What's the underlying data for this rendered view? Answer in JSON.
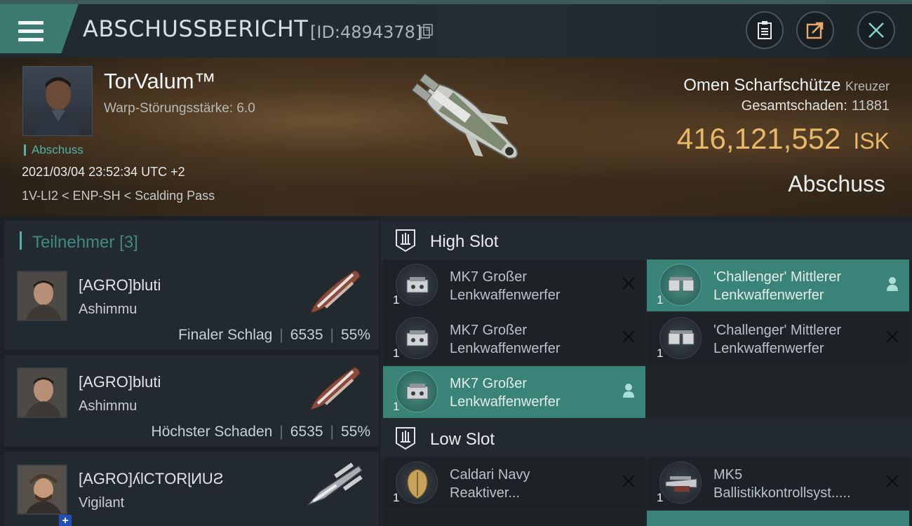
{
  "header": {
    "title": "ABSCHUSSBERICHT",
    "id_text": "[ID:4894378]"
  },
  "victim": {
    "pilot_name": "TorValum™",
    "warp_strength": "Warp-Störungsstärke: 6.0",
    "kill_tag": "Abschuss",
    "datetime": "2021/03/04 23:52:34 UTC +2",
    "location": "1V-LI2 < ENP-SH < Scalding Pass",
    "ship_name": "Omen Scharfschütze",
    "ship_class": "Kreuzer",
    "damage_label": "Gesamtschaden:",
    "damage_value": "11881",
    "isk_value": "416,121,552",
    "isk_unit": "ISK",
    "outcome": "Abschuss"
  },
  "participants": {
    "header_label": "Teilnehmer",
    "header_count": "[3]",
    "items": [
      {
        "name": "[AGRO]bluti",
        "ship": "Ashimmu",
        "role": "Finaler Schlag",
        "damage": "6535",
        "percent": "55%"
      },
      {
        "name": "[AGRO]bluti",
        "ship": "Ashimmu",
        "role": "Höchster Schaden",
        "damage": "6535",
        "percent": "55%"
      },
      {
        "name": "[AGRO]ʎlCΤORɭИUƧ",
        "ship": "Vigilant",
        "role": "",
        "damage": "",
        "percent": ""
      }
    ]
  },
  "slots": {
    "high_label": "High Slot",
    "low_label": "Low Slot",
    "high": [
      {
        "qty": "1",
        "line1": "MK7 Großer",
        "line2": "Lenkwaffenwerfer",
        "state": "destroyed"
      },
      {
        "qty": "1",
        "line1": "'Challenger' Mittlerer",
        "line2": "Lenkwaffenwerfer",
        "state": "dropped"
      },
      {
        "qty": "1",
        "line1": "MK7 Großer",
        "line2": "Lenkwaffenwerfer",
        "state": "destroyed"
      },
      {
        "qty": "1",
        "line1": "'Challenger' Mittlerer",
        "line2": "Lenkwaffenwerfer",
        "state": "destroyed"
      },
      {
        "qty": "1",
        "line1": "MK7 Großer",
        "line2": "Lenkwaffenwerfer",
        "state": "dropped"
      }
    ],
    "low": [
      {
        "qty": "1",
        "line1": "Caldari Navy",
        "line2": "Reaktiver...",
        "state": "destroyed"
      },
      {
        "qty": "1",
        "line1": "MK5",
        "line2": "Ballistikkontrollsyst.....",
        "state": "destroyed"
      }
    ]
  },
  "colors": {
    "accent": "#4fb3a6",
    "active_module": "#3a8379",
    "isk": "#e8b86a"
  }
}
